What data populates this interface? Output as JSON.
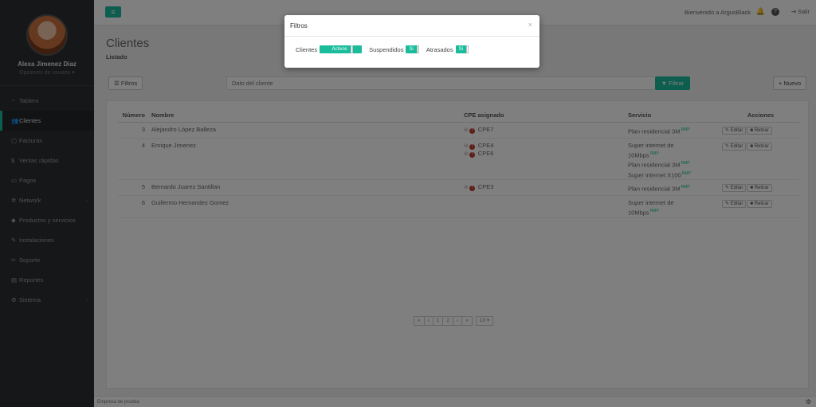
{
  "sidebar": {
    "user_name": "Alexa Jimenez Diaz",
    "user_options": "Opciones de usuario ▾",
    "items": [
      {
        "label": "Tablero",
        "icon": "dashboard-icon"
      },
      {
        "label": "Clientes",
        "icon": "users-icon",
        "active": true
      },
      {
        "label": "Facturas",
        "icon": "file-icon"
      },
      {
        "label": "Ventas rápidas",
        "icon": "dollar-icon"
      },
      {
        "label": "Pagos",
        "icon": "money-icon"
      },
      {
        "label": "Network",
        "icon": "gear-icon",
        "chevron": true
      },
      {
        "label": "Productos y servicios",
        "icon": "tag-icon"
      },
      {
        "label": "Instalaciones",
        "icon": "wrench-icon"
      },
      {
        "label": "Soporte",
        "icon": "tools-icon"
      },
      {
        "label": "Reportes",
        "icon": "book-icon"
      },
      {
        "label": "Sistema",
        "icon": "cogs-icon",
        "chevron": true
      }
    ]
  },
  "topbar": {
    "menu_icon": "≡",
    "welcome": "Bienvenido a ArgusBlack",
    "logout": "Salir"
  },
  "main": {
    "title": "Clientes",
    "subtitle": "Listado",
    "filters_button": "Filtros",
    "search_placeholder": "Dato del cliente",
    "filter_button": "Filtrar",
    "new_button": "Nuevo"
  },
  "table": {
    "headers": {
      "number": "Número",
      "name": "Nombre",
      "cpe": "CPE asignado",
      "service": "Servicio",
      "actions": "Acciones"
    },
    "rows": [
      {
        "number": "3",
        "name": "Alejandro López Balleza",
        "cpe": [
          "CPE7"
        ],
        "services": [
          {
            "text": "Plan residencial 3M",
            "tag": "RMP"
          }
        ]
      },
      {
        "number": "4",
        "name": "Enrique Jimenez",
        "cpe": [
          "CPE4",
          "CPE6"
        ],
        "services": [
          {
            "text": "Super internet de",
            "tag": ""
          },
          {
            "text": "10Mbps",
            "tag": "RMP"
          },
          {
            "text": "Plan residencial 3M",
            "tag": "RMP"
          },
          {
            "text": "Super internet X100",
            "tag": "RMP"
          }
        ]
      },
      {
        "number": "5",
        "name": "Bernardo Juarez Santillan",
        "cpe": [
          "CPE3"
        ],
        "services": [
          {
            "text": "Plan residencial 3M",
            "tag": "RMP"
          }
        ]
      },
      {
        "number": "6",
        "name": "Guillermo Hernandez Gomez",
        "cpe": [],
        "services": [
          {
            "text": "Super internet de",
            "tag": ""
          },
          {
            "text": "10Mbps",
            "tag": "RMP"
          }
        ]
      }
    ],
    "edit_label": "Editar",
    "remove_label": "Retirar"
  },
  "pagination": {
    "first": "«",
    "prev": "‹",
    "pages": [
      "1",
      "2"
    ],
    "next": "›",
    "last": "»",
    "per_page": "10 ▾"
  },
  "footer": {
    "text": "Empresa de prueba"
  },
  "modal": {
    "title": "Filtros",
    "close": "×",
    "clients_label": "Clientes",
    "clients_value": "Activos",
    "suspended_label": "Suspendidos",
    "suspended_value": "Si",
    "late_label": "Atrasados",
    "late_value": "Si"
  }
}
